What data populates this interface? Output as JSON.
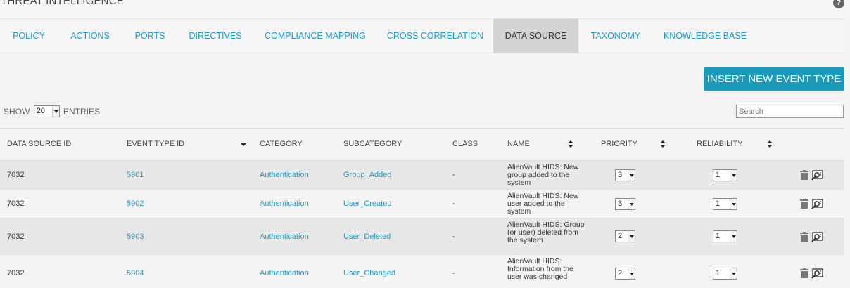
{
  "header": {
    "title": "THREAT INTELLIGENCE",
    "help": "?"
  },
  "tabs": [
    {
      "label": "POLICY",
      "active": false
    },
    {
      "label": "ACTIONS",
      "active": false
    },
    {
      "label": "PORTS",
      "active": false
    },
    {
      "label": "DIRECTIVES",
      "active": false
    },
    {
      "label": "COMPLIANCE MAPPING",
      "active": false
    },
    {
      "label": "CROSS CORRELATION",
      "active": false
    },
    {
      "label": "DATA SOURCE",
      "active": true
    },
    {
      "label": "TAXONOMY",
      "active": false
    },
    {
      "label": "KNOWLEDGE BASE",
      "active": false
    }
  ],
  "toolbar": {
    "insert_label": "INSERT NEW EVENT TYPE"
  },
  "entries": {
    "show_label": "SHOW",
    "value": "20",
    "entries_label": "ENTRIES"
  },
  "search": {
    "placeholder": "Search",
    "value": ""
  },
  "table": {
    "columns": {
      "data_source_id": "DATA SOURCE ID",
      "event_type_id": "EVENT TYPE ID",
      "category": "CATEGORY",
      "subcategory": "SUBCATEGORY",
      "class": "CLASS",
      "name": "NAME",
      "priority": "PRIORITY",
      "reliability": "RELIABILITY"
    },
    "rows": [
      {
        "data_source_id": "7032",
        "event_type_id": "5901",
        "category": "Authentication",
        "subcategory": "Group_Added",
        "class": "-",
        "name": "AlienVault HIDS: New group added to the system",
        "priority": "3",
        "reliability": "1"
      },
      {
        "data_source_id": "7032",
        "event_type_id": "5902",
        "category": "Authentication",
        "subcategory": "User_Created",
        "class": "-",
        "name": "AlienVault HIDS: New user added to the system",
        "priority": "3",
        "reliability": "1"
      },
      {
        "data_source_id": "7032",
        "event_type_id": "5903",
        "category": "Authentication",
        "subcategory": "User_Deleted",
        "class": "-",
        "name": "AlienVault HIDS: Group (or user) deleted from the system",
        "priority": "2",
        "reliability": "1"
      },
      {
        "data_source_id": "7032",
        "event_type_id": "5904",
        "category": "Authentication",
        "subcategory": "User_Changed",
        "class": "-",
        "name": "AlienVault HIDS: Information from the user was changed",
        "priority": "2",
        "reliability": "1"
      }
    ]
  },
  "icons": {
    "delete": "trash-icon",
    "view": "view-details-icon"
  },
  "colors": {
    "accent": "#1b99bb",
    "link": "#1b9dc4",
    "active_tab": "#d3d3d3"
  }
}
